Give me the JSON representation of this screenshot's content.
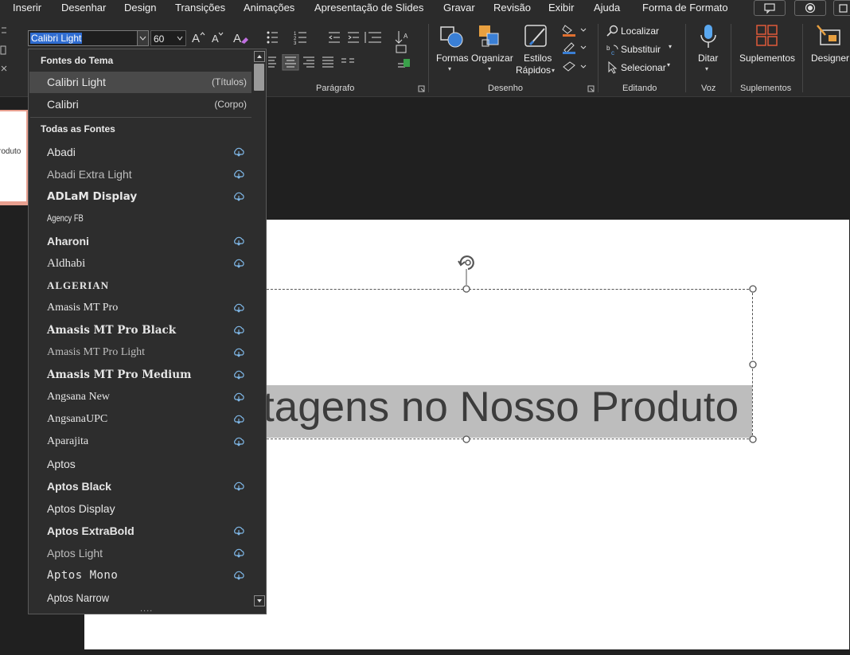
{
  "menubar": {
    "items": [
      "Inserir",
      "Desenhar",
      "Design",
      "Transições",
      "Animações",
      "Apresentação de Slides",
      "Gravar",
      "Revisão",
      "Exibir",
      "Ajuda",
      "Forma de Formato"
    ]
  },
  "font_box": {
    "font": "Calibri Light",
    "size": "60"
  },
  "ribbon": {
    "groups": {
      "paragrafo": "Parágrafo",
      "desenho": "Desenho",
      "editando": "Editando",
      "voz": "Voz",
      "suplementos": "Suplementos"
    },
    "buttons": {
      "formas": "Formas",
      "organizar": "Organizar",
      "estilos1": "Estilos",
      "estilos2": "Rápidos",
      "localizar": "Localizar",
      "substituir": "Substituir",
      "selecionar": "Selecionar",
      "ditar": "Ditar",
      "suplementos": "Suplementos",
      "designer": "Designer"
    }
  },
  "dropdown": {
    "theme_header": "Fontes do Tema",
    "theme_fonts": [
      {
        "name": "Calibri Light",
        "tag": "(Títulos)"
      },
      {
        "name": "Calibri",
        "tag": "(Corpo)"
      }
    ],
    "all_header": "Todas as Fontes",
    "fonts": [
      {
        "name": "Abadi",
        "cloud": true
      },
      {
        "name": "Abadi Extra Light",
        "cloud": true
      },
      {
        "name": "ADLaM Display",
        "cloud": true
      },
      {
        "name": "Agency FB",
        "cloud": false
      },
      {
        "name": "Aharoni",
        "cloud": true
      },
      {
        "name": "Aldhabi",
        "cloud": true
      },
      {
        "name": "ALGERIAN",
        "cloud": false
      },
      {
        "name": "Amasis MT Pro",
        "cloud": true
      },
      {
        "name": "Amasis MT Pro Black",
        "cloud": true
      },
      {
        "name": "Amasis MT Pro Light",
        "cloud": true
      },
      {
        "name": "Amasis MT Pro Medium",
        "cloud": true
      },
      {
        "name": "Angsana New",
        "cloud": true
      },
      {
        "name": "AngsanaUPC",
        "cloud": true
      },
      {
        "name": "Aparajita",
        "cloud": true
      },
      {
        "name": "Aptos",
        "cloud": false
      },
      {
        "name": "Aptos Black",
        "cloud": true
      },
      {
        "name": "Aptos Display",
        "cloud": false
      },
      {
        "name": "Aptos ExtraBold",
        "cloud": true
      },
      {
        "name": "Aptos Light",
        "cloud": true
      },
      {
        "name": "Aptos Mono",
        "cloud": true
      },
      {
        "name": "Aptos Narrow",
        "cloud": false
      }
    ],
    "more": "....",
    "colors": {
      "cloud": "#7fb8e8"
    }
  },
  "slide": {
    "title_text": "tagens no Nosso Produto",
    "thumb_text": "roduto"
  }
}
